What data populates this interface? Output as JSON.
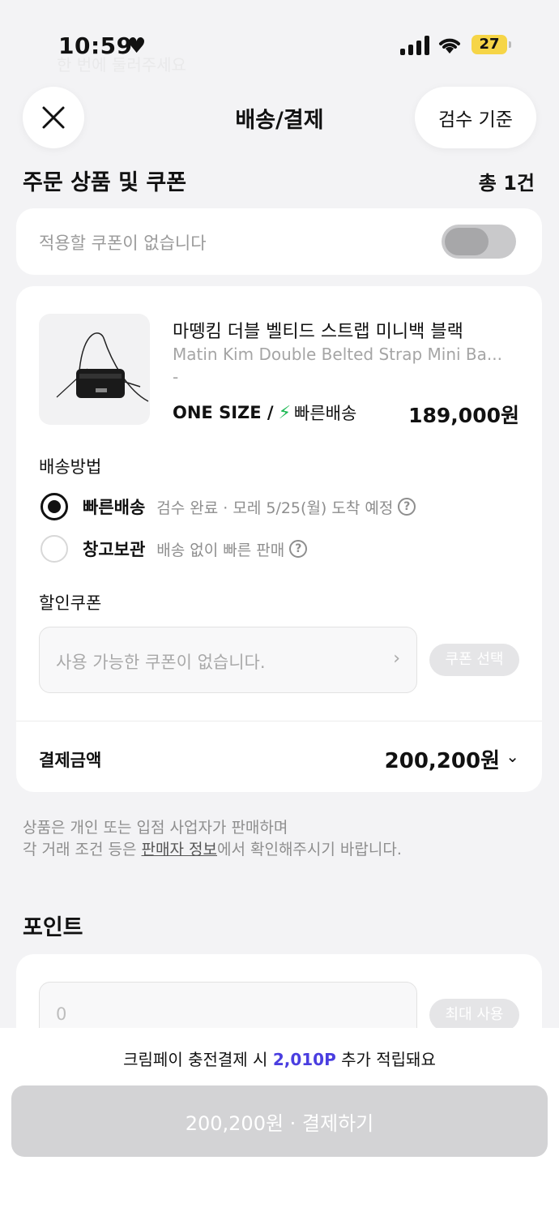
{
  "status_bar": {
    "time": "10:59",
    "battery": "27"
  },
  "ghost_text": "한 번에 둘러주세요",
  "header": {
    "title": "배송/결제",
    "criteria_label": "검수 기준"
  },
  "order_section": {
    "title": "주문 상품 및 쿠폰",
    "count": "총 1건"
  },
  "coupon_toggle": {
    "text": "적용할 쿠폰이 없습니다",
    "enabled": false
  },
  "product": {
    "name_ko": "마뗑킴 더블 벨티드 스트랩 미니백 블랙",
    "name_en": "Matin Kim Double Belted Strap Mini Ba...",
    "sub": "-",
    "option": "ONE SIZE /",
    "delivery_badge": "빠른배송",
    "price": "189,000원"
  },
  "shipping": {
    "label": "배송방법",
    "options": [
      {
        "label": "빠른배송",
        "desc": "검수 완료 · 모레 5/25(월) 도착 예정",
        "selected": true
      },
      {
        "label": "창고보관",
        "desc": "배송 없이 빠른 판매",
        "selected": false
      }
    ]
  },
  "discount": {
    "label": "할인쿠폰",
    "placeholder": "사용 가능한 쿠폰이 없습니다.",
    "button": "쿠폰 선택"
  },
  "payment": {
    "label": "결제금액",
    "amount": "200,200원"
  },
  "notice": {
    "line1": "상품은 개인 또는 입점 사업자가 판매하며",
    "line2_pre": "각 거래 조건 등은 ",
    "line2_link": "판매자 정보",
    "line2_post": "에서 확인해주시기 바랍니다."
  },
  "points": {
    "title": "포인트",
    "value": "0",
    "button": "최대 사용"
  },
  "bottom": {
    "promo_pre": "크림페이 충전결제 시 ",
    "promo_points": "2,010P",
    "promo_post": " 추가 적립돼요",
    "pay_button": "200,200원 · 결제하기"
  },
  "colors": {
    "accent": "#4a3ee0",
    "fast_delivery": "#1db954",
    "battery": "#f6d547"
  }
}
